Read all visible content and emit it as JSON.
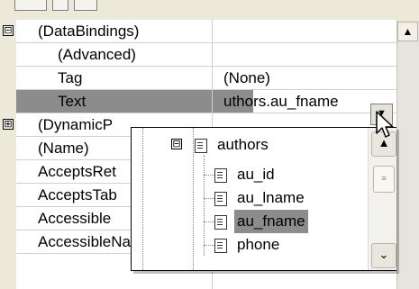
{
  "properties": [
    {
      "name": "(DataBindings)",
      "value": "",
      "expander": "minus"
    },
    {
      "name": "(Advanced)",
      "value": "",
      "indent": true
    },
    {
      "name": "Tag",
      "value": "(None)",
      "indent": true
    },
    {
      "name": "Text",
      "value": "uthors.au_fname",
      "indent": true,
      "selected": true
    },
    {
      "name": "(DynamicP",
      "value": "",
      "expander": "plus"
    },
    {
      "name": "(Name)",
      "value": ""
    },
    {
      "name": "AcceptsRet",
      "value": ""
    },
    {
      "name": "AcceptsTab",
      "value": ""
    },
    {
      "name": "Accessible",
      "value": ""
    },
    {
      "name": "AccessibleName",
      "value": ""
    }
  ],
  "dropdown": {
    "root": {
      "label": "authors",
      "expander": "minus"
    },
    "fields": [
      {
        "label": "au_id",
        "highlighted": false
      },
      {
        "label": "au_lname",
        "highlighted": false
      },
      {
        "label": "au_fname",
        "highlighted": true
      },
      {
        "label": "phone",
        "highlighted": false
      }
    ]
  },
  "icons": {
    "expander_minus": "⊟",
    "expander_plus": "⊞",
    "dropdown_arrow": "▼",
    "scroll_up": "▲",
    "scroll_down": "⌄"
  },
  "colors": {
    "selection": "#8c8c8c",
    "window": "#ece9d8"
  }
}
